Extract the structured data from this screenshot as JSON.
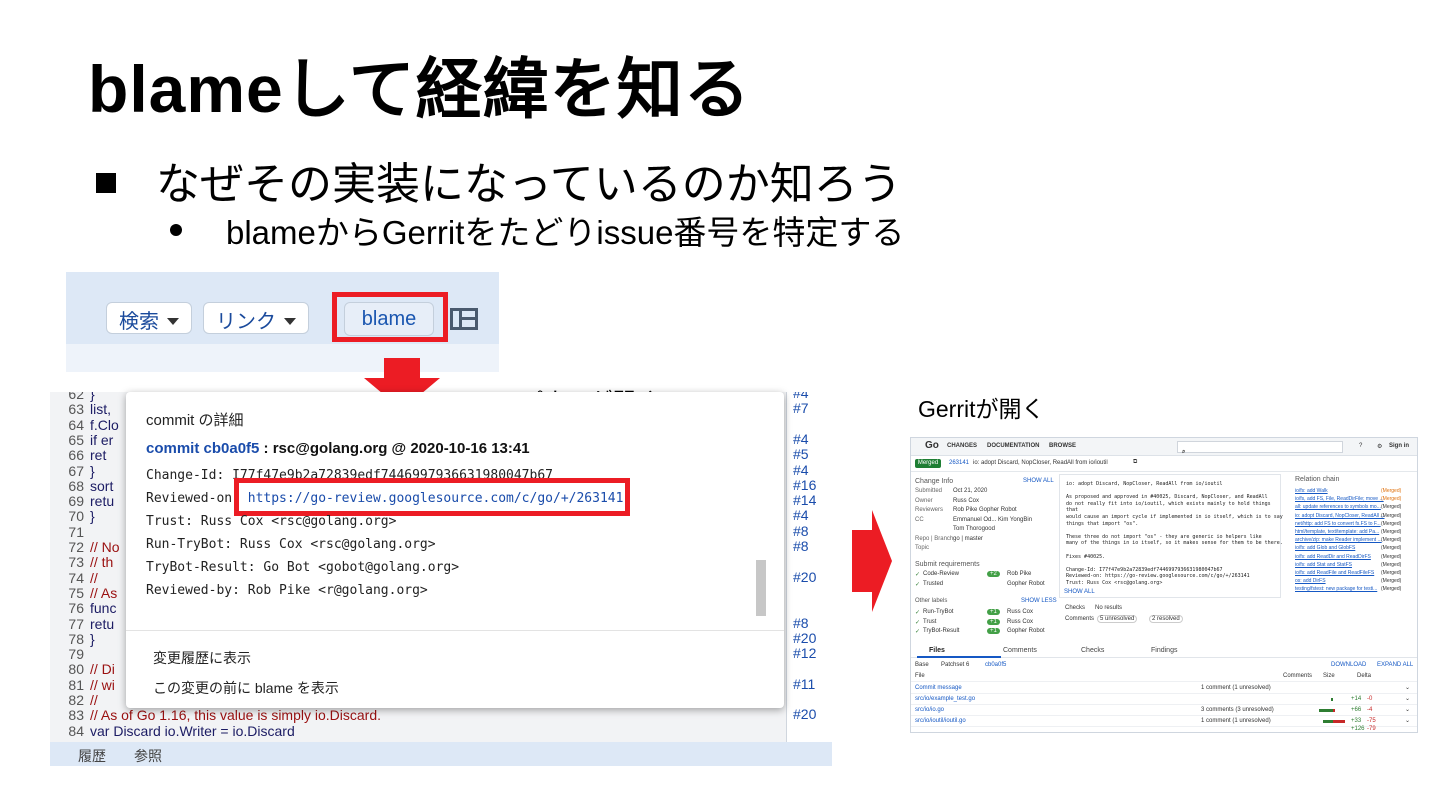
{
  "slide": {
    "title": "blameして経緯を知る",
    "bullet1": "なぜその実装になっているのか知ろう",
    "bullet2": "blameからGerritをたどりissue番号を特定する",
    "caption_blame": "blameパネルが開く",
    "caption_gerrit": "Gerritが開く"
  },
  "colors": {
    "highlight": "#ec1c24",
    "link": "#1a4cab",
    "toolbar_bg": "#dde8f6"
  },
  "toolbar": {
    "search_label": "検索",
    "link_label": "リンク",
    "blame_label": "blame",
    "layout_icon": "layout-panel-icon"
  },
  "code": {
    "lines": [
      {
        "n": "62",
        "t": "}"
      },
      {
        "n": "63",
        "t": "list,"
      },
      {
        "n": "64",
        "t": "f.Clo"
      },
      {
        "n": "65",
        "t": "if er"
      },
      {
        "n": "66",
        "t": "ret"
      },
      {
        "n": "67",
        "t": "}"
      },
      {
        "n": "68",
        "t": "sort"
      },
      {
        "n": "69",
        "t": "retu"
      },
      {
        "n": "70",
        "t": "}"
      },
      {
        "n": "71",
        "t": ""
      },
      {
        "n": "72",
        "t": "// No"
      },
      {
        "n": "73",
        "t": "// th"
      },
      {
        "n": "74",
        "t": "//"
      },
      {
        "n": "75",
        "t": "// As"
      },
      {
        "n": "76",
        "t": "func"
      },
      {
        "n": "77",
        "t": "retu"
      },
      {
        "n": "78",
        "t": "}"
      },
      {
        "n": "79",
        "t": ""
      },
      {
        "n": "80",
        "t": "// Di"
      },
      {
        "n": "81",
        "t": "// wi"
      },
      {
        "n": "82",
        "t": "//"
      },
      {
        "n": "83",
        "t": "// As of Go 1.16, this value is simply io.Discard."
      },
      {
        "n": "84",
        "t": "var Discard io.Writer = io.Discard"
      }
    ],
    "blame_refs": [
      {
        "label": "#4",
        "row": 0
      },
      {
        "label": "#7",
        "row": 1
      },
      {
        "label": "#4",
        "row": 3
      },
      {
        "label": "#5",
        "row": 4
      },
      {
        "label": "#4",
        "row": 5
      },
      {
        "label": "#16",
        "row": 6
      },
      {
        "label": "#14",
        "row": 7
      },
      {
        "label": "#4",
        "row": 8
      },
      {
        "label": "#8",
        "row": 9
      },
      {
        "label": "#8",
        "row": 10
      },
      {
        "label": "#20",
        "row": 12
      },
      {
        "label": "#8",
        "row": 15
      },
      {
        "label": "#20",
        "row": 16
      },
      {
        "label": "#12",
        "row": 17
      },
      {
        "label": "#11",
        "row": 19
      },
      {
        "label": "#20",
        "row": 21
      }
    ],
    "footer_history": "履歴",
    "footer_refs": "参照"
  },
  "popup": {
    "heading": "commit の詳細",
    "commit_hash": "commit cb0a0f5",
    "commit_meta": " : rsc@golang.org @ 2020-10-16 13:41",
    "change_id": "Change-Id: I77f47e9b2a72839edf7446997936631980047b67",
    "reviewed_on_label": "Reviewed-on: ",
    "reviewed_on_url": "https://go-review.googlesource.com/c/go/+/263141",
    "trust": "Trust: Russ Cox <rsc@golang.org>",
    "run_trybot": "Run-TryBot: Russ Cox <rsc@golang.org>",
    "trybot_result": "TryBot-Result: Go Bot <gobot@golang.org>",
    "reviewed_by": "Reviewed-by: Rob Pike <r@golang.org>",
    "menu_history": "変更履歴に表示",
    "menu_blame_before": "この変更の前に blame を表示"
  },
  "gerrit": {
    "logo": "Go",
    "nav": [
      "CHANGES",
      "DOCUMENTATION",
      "BROWSE"
    ],
    "signin": "Sign in",
    "status": "Merged",
    "change_num": "263141",
    "change_title": "io: adopt Discard, NopCloser, ReadAll from io/ioutil",
    "change_info": "Change Info",
    "show_all": "SHOW ALL",
    "info_rows": [
      {
        "k": "Submitted",
        "v": "Oct 21, 2020"
      },
      {
        "k": "Owner",
        "v": "Russ Cox"
      },
      {
        "k": "Reviewers",
        "v": "Rob Pike   Gopher Robot"
      },
      {
        "k": "CC",
        "v": "Emmanuel Od...   Kim YongBin"
      },
      {
        "k": "",
        "v": "Tom Thorogood"
      },
      {
        "k": "Repo | Branch",
        "v": "go | master"
      },
      {
        "k": "Topic",
        "v": ""
      }
    ],
    "submit_req": "Submit requirements",
    "req_rows": [
      {
        "k": "Code-Review",
        "score": "+2",
        "who": "Rob Pike"
      },
      {
        "k": "Trusted",
        "score": "",
        "who": "Gopher Robot"
      }
    ],
    "other_labels": "Other labels",
    "show_less": "SHOW LESS",
    "label_rows": [
      {
        "k": "Run-TryBot",
        "score": "+1",
        "who": "Russ Cox"
      },
      {
        "k": "Trust",
        "score": "+1",
        "who": "Russ Cox"
      },
      {
        "k": "TryBot-Result",
        "score": "+1",
        "who": "Gopher Robot"
      }
    ],
    "msg_lines": [
      "io: adopt Discard, NopCloser, ReadAll from io/ioutil",
      "",
      "As proposed and approved in #40025, Discard, NopCloser, and ReadAll",
      "do not really fit into io/ioutil, which exists mainly to hold things",
      "that",
      "would cause an import cycle if implemented in io itself, which is to say",
      "things that import \"os\".",
      "",
      "These three do not import \"os\" - they are generic io helpers like",
      "many of the things in io itself, so it makes sense for them to be there.",
      "",
      "Fixes #40025.",
      "",
      "Change-Id: I77f47e9b2a72839edf7446997936631980047b67",
      "Reviewed-on: https://go-review.googlesource.com/c/go/+/263141",
      "Trust: Russ Cox <rsc@golang.org>"
    ],
    "show_all_msg": "SHOW ALL",
    "checks_label": "Checks",
    "checks_value": "No results",
    "comments_label": "Comments",
    "comments_unresolved": "5 unresolved",
    "comments_resolved": "2 resolved",
    "relation_chain": "Relation chain",
    "relations": [
      {
        "t": "io/fs: add Walk",
        "s": "(Merged)"
      },
      {
        "t": "io/fs, add FS, File, ReadDirFile; move ...",
        "s": "(Merged)"
      },
      {
        "t": "all: update references to symbols mo...",
        "s": "(Merged)"
      },
      {
        "t": "io: adopt Discard, NopCloser, ReadAll ...",
        "s": "(Merged)"
      },
      {
        "t": "net/http: add FS to convert fs.FS to F...",
        "s": "(Merged)"
      },
      {
        "t": "html/template, text/template: add Pa...",
        "s": "(Merged)"
      },
      {
        "t": "archive/zip: make Reader implement ...",
        "s": "(Merged)"
      },
      {
        "t": "io/fs: add Glob and GlobFS",
        "s": "(Merged)"
      },
      {
        "t": "io/fs: add ReadDir and ReadDirFS",
        "s": "(Merged)"
      },
      {
        "t": "io/fs: add Stat and StatFS",
        "s": "(Merged)"
      },
      {
        "t": "io/fs: add ReadFile and ReadFileFS",
        "s": "(Merged)"
      },
      {
        "t": "os: add DirFS",
        "s": "(Merged)"
      },
      {
        "t": "testing/fstest: new package for testi...",
        "s": "(Merged)"
      }
    ],
    "tabs": [
      "Files",
      "Comments",
      "Checks",
      "Findings"
    ],
    "base": "Base",
    "patchset": "Patchset 6",
    "patch_hash": "cb0a0f5",
    "download": "DOWNLOAD",
    "expand_all": "EXPAND ALL",
    "file_header": {
      "file": "File",
      "comments": "Comments",
      "size": "Size",
      "delta": "Delta"
    },
    "files": [
      {
        "name": "Commit message",
        "comments": "1 comment (1 unresolved)",
        "plus": "",
        "minus": ""
      },
      {
        "name": "src/io/example_test.go",
        "comments": "",
        "plus": "+14",
        "minus": "-0"
      },
      {
        "name": "src/io/io.go",
        "comments": "3 comments (3 unresolved)",
        "plus": "+66",
        "minus": "-4"
      },
      {
        "name": "src/io/ioutil/ioutil.go",
        "comments": "1 comment (1 unresolved)",
        "plus": "+33",
        "minus": "-75"
      }
    ],
    "totals": {
      "plus": "+126",
      "minus": "-79"
    }
  }
}
